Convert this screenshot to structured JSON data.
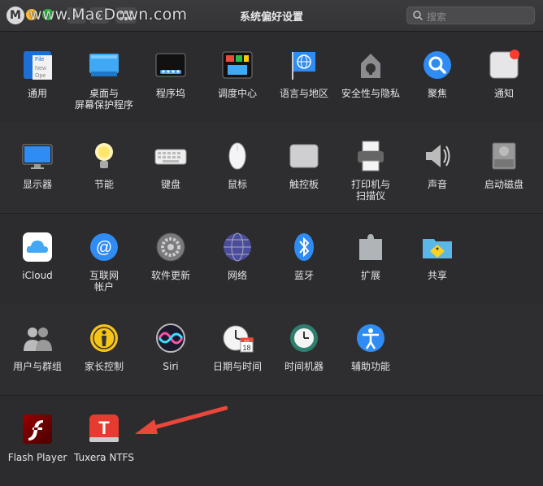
{
  "window": {
    "title": "系统偏好设置",
    "watermark": "www.MacDown.com",
    "watermark_logo": "M",
    "search_placeholder": "搜索"
  },
  "rows": [
    {
      "items": [
        {
          "label": "通用",
          "icon": "general-icon"
        },
        {
          "label": "桌面与\n屏幕保护程序",
          "icon": "desktop-screensaver-icon"
        },
        {
          "label": "程序坞",
          "icon": "dock-icon"
        },
        {
          "label": "调度中心",
          "icon": "mission-control-icon"
        },
        {
          "label": "语言与地区",
          "icon": "language-region-icon"
        },
        {
          "label": "安全性与隐私",
          "icon": "security-privacy-icon"
        },
        {
          "label": "聚焦",
          "icon": "spotlight-icon"
        },
        {
          "label": "通知",
          "icon": "notifications-icon"
        }
      ]
    },
    {
      "items": [
        {
          "label": "显示器",
          "icon": "displays-icon"
        },
        {
          "label": "节能",
          "icon": "energy-saver-icon"
        },
        {
          "label": "键盘",
          "icon": "keyboard-icon"
        },
        {
          "label": "鼠标",
          "icon": "mouse-icon"
        },
        {
          "label": "触控板",
          "icon": "trackpad-icon"
        },
        {
          "label": "打印机与\n扫描仪",
          "icon": "printers-scanners-icon"
        },
        {
          "label": "声音",
          "icon": "sound-icon"
        },
        {
          "label": "启动磁盘",
          "icon": "startup-disk-icon"
        }
      ]
    },
    {
      "items": [
        {
          "label": "iCloud",
          "icon": "icloud-icon"
        },
        {
          "label": "互联网\n帐户",
          "icon": "internet-accounts-icon"
        },
        {
          "label": "软件更新",
          "icon": "software-update-icon"
        },
        {
          "label": "网络",
          "icon": "network-icon"
        },
        {
          "label": "蓝牙",
          "icon": "bluetooth-icon"
        },
        {
          "label": "扩展",
          "icon": "extensions-icon"
        },
        {
          "label": "共享",
          "icon": "sharing-icon"
        }
      ]
    },
    {
      "items": [
        {
          "label": "用户与群组",
          "icon": "users-groups-icon"
        },
        {
          "label": "家长控制",
          "icon": "parental-controls-icon"
        },
        {
          "label": "Siri",
          "icon": "siri-icon"
        },
        {
          "label": "日期与时间",
          "icon": "date-time-icon"
        },
        {
          "label": "时间机器",
          "icon": "time-machine-icon"
        },
        {
          "label": "辅助功能",
          "icon": "accessibility-icon"
        }
      ]
    },
    {
      "items": [
        {
          "label": "Flash Player",
          "icon": "flash-player-icon"
        },
        {
          "label": "Tuxera NTFS",
          "icon": "tuxera-ntfs-icon"
        }
      ]
    }
  ],
  "icon_text": {
    "general_file": "File",
    "general_new": "New",
    "general_ope": "Ope",
    "calendar_month": "JUL",
    "calendar_day": "18",
    "tuxera_letter": "T"
  },
  "colors": {
    "annotation_arrow": "#e8473a",
    "accent": "#2f8cf4"
  }
}
